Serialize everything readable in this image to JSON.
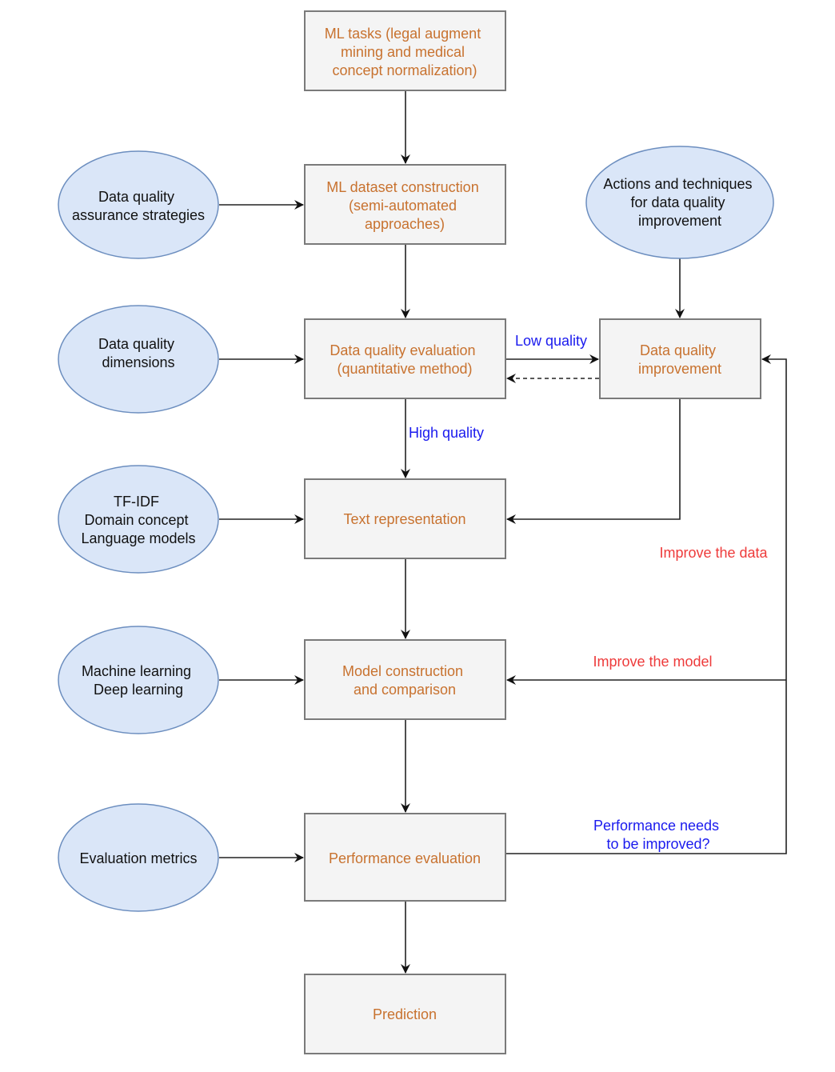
{
  "diagram": {
    "boxes": {
      "ml_tasks": [
        "ML tasks (legal augment",
        "mining and medical",
        "concept normalization)"
      ],
      "dataset_construction": [
        "ML dataset construction",
        "(semi-automated",
        "approaches)"
      ],
      "dq_evaluation": [
        "Data quality evaluation",
        "(quantitative method)"
      ],
      "dq_improvement": [
        "Data quality",
        "improvement"
      ],
      "text_representation": [
        "Text representation"
      ],
      "model_construction": [
        "Model construction",
        "and comparison"
      ],
      "performance_evaluation": [
        "Performance evaluation"
      ],
      "prediction": [
        "Prediction"
      ]
    },
    "ovals": {
      "dq_assurance": [
        "Data quality",
        "assurance strategies"
      ],
      "dq_dimensions": [
        "Data quality",
        "dimensions"
      ],
      "representations": [
        "TF-IDF",
        "Domain concept",
        "Language models"
      ],
      "learning": [
        "Machine learning",
        "Deep learning"
      ],
      "metrics": [
        "Evaluation metrics"
      ],
      "dq_actions": [
        "Actions and techniques",
        "for data quality",
        "improvement"
      ]
    },
    "edge_labels": {
      "low_quality": "Low quality",
      "high_quality": "High quality",
      "improve_data": "Improve the data",
      "improve_model": "Improve the model",
      "performance_needs": [
        "Performance needs",
        "to be improved?"
      ]
    },
    "colors": {
      "box_fill": "#f4f4f4",
      "box_stroke": "#7a7a7a",
      "box_text": "#c8722f",
      "oval_fill": "#dae6f8",
      "oval_stroke": "#6c8ebf",
      "oval_text": "#111111",
      "condition_label": "#1a1aee",
      "loop_label": "#ee3b3b",
      "edge": "#222222"
    }
  }
}
